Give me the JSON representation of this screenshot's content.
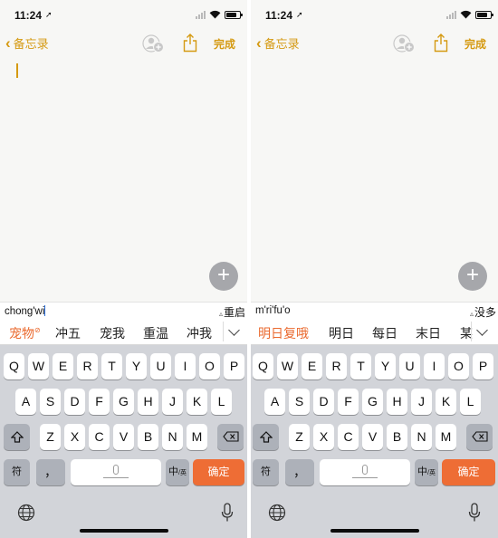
{
  "screens": [
    {
      "status": {
        "time": "11:24",
        "loc_glyph": "➚"
      },
      "nav": {
        "back_label": "备忘录",
        "done_label": "完成"
      },
      "composition": {
        "pinyin": "chong'wi",
        "action_label": "重启"
      },
      "candidates": [
        {
          "text": "宠物",
          "active": true,
          "sup": "⊘"
        },
        {
          "text": "冲五"
        },
        {
          "text": "宠我"
        },
        {
          "text": "重温"
        },
        {
          "text": "冲我"
        }
      ]
    },
    {
      "status": {
        "time": "11:24",
        "loc_glyph": "➚"
      },
      "nav": {
        "back_label": "备忘录",
        "done_label": "完成"
      },
      "composition": {
        "pinyin": "m'ri'fu'o",
        "action_label": "没多"
      },
      "candidates": [
        {
          "text": "明日复哦",
          "active": true
        },
        {
          "text": "明日"
        },
        {
          "text": "每日"
        },
        {
          "text": "末日"
        },
        {
          "text": "某"
        }
      ]
    }
  ],
  "keyboard": {
    "row1": [
      "Q",
      "W",
      "E",
      "R",
      "T",
      "Y",
      "U",
      "I",
      "O",
      "P"
    ],
    "row2": [
      "A",
      "S",
      "D",
      "F",
      "G",
      "H",
      "J",
      "K",
      "L"
    ],
    "row3": [
      "Z",
      "X",
      "C",
      "V",
      "B",
      "N",
      "M"
    ],
    "fu_label": "符",
    "punct_label": "，",
    "lang_label": "中",
    "lang_sub": "/英",
    "confirm_label": "确定",
    "fab_label": "+"
  },
  "colors": {
    "accent": "#d59a12",
    "candidate_active": "#ea6a2f",
    "confirm": "#ee6d35"
  }
}
